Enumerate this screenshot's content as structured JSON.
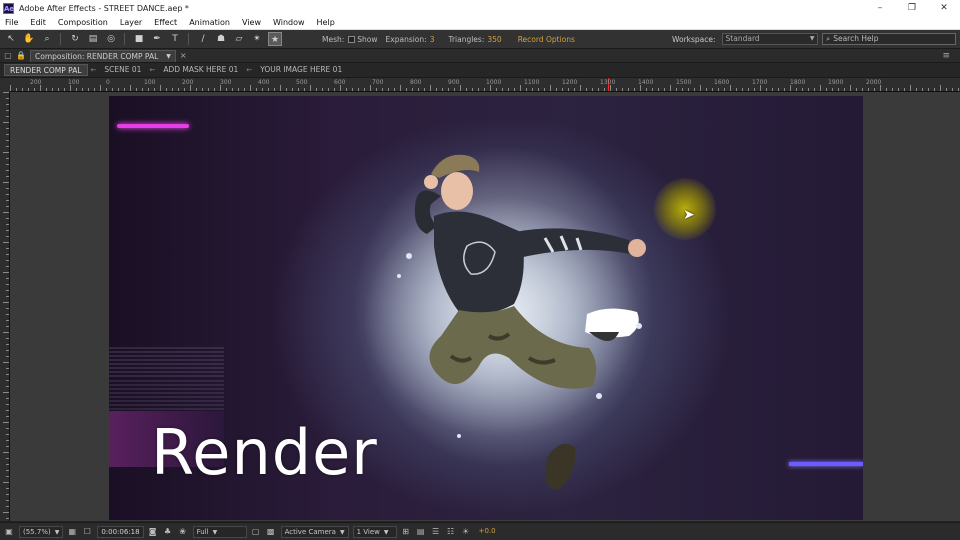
{
  "window": {
    "app_icon": "Ae",
    "title": "Adobe After Effects - STREET DANCE.aep *",
    "controls": {
      "minimize": "–",
      "restore": "❐",
      "close": "✕"
    }
  },
  "menubar": {
    "items": [
      "File",
      "Edit",
      "Composition",
      "Layer",
      "Effect",
      "Animation",
      "View",
      "Window",
      "Help"
    ]
  },
  "toolbar": {
    "mesh_label": "Mesh:",
    "show_label": "Show",
    "expansion_label": "Expansion:",
    "expansion_value": "3",
    "triangles_label": "Triangles:",
    "triangles_value": "350",
    "record_options": "Record Options",
    "workspace_label": "Workspace:",
    "workspace_value": "Standard",
    "search_placeholder": "Search Help"
  },
  "panel": {
    "composition_tab": "Composition: RENDER COMP PAL"
  },
  "breadcrumbs": [
    "RENDER COMP PAL",
    "SCENE 01",
    "ADD MASK HERE 01",
    "YOUR IMAGE HERE 01"
  ],
  "ruler_labels": [
    "200",
    "100",
    "0",
    "100",
    "200",
    "300",
    "400",
    "500",
    "600",
    "700",
    "800",
    "900",
    "1000",
    "1100",
    "1200",
    "1300",
    "1400",
    "1500",
    "1600",
    "1700",
    "1800",
    "1900",
    "2000"
  ],
  "composition": {
    "title_text": "Render",
    "accent_magenta": "#e63ee6",
    "accent_violet": "#6a5cff",
    "cursor_glow": "#d2c800"
  },
  "viewer_controls": {
    "zoom": "(55.7%)",
    "timecode": "0:00:06:18",
    "resolution": "Full",
    "camera": "Active Camera",
    "view": "1 View",
    "exposure": "+0.0"
  }
}
